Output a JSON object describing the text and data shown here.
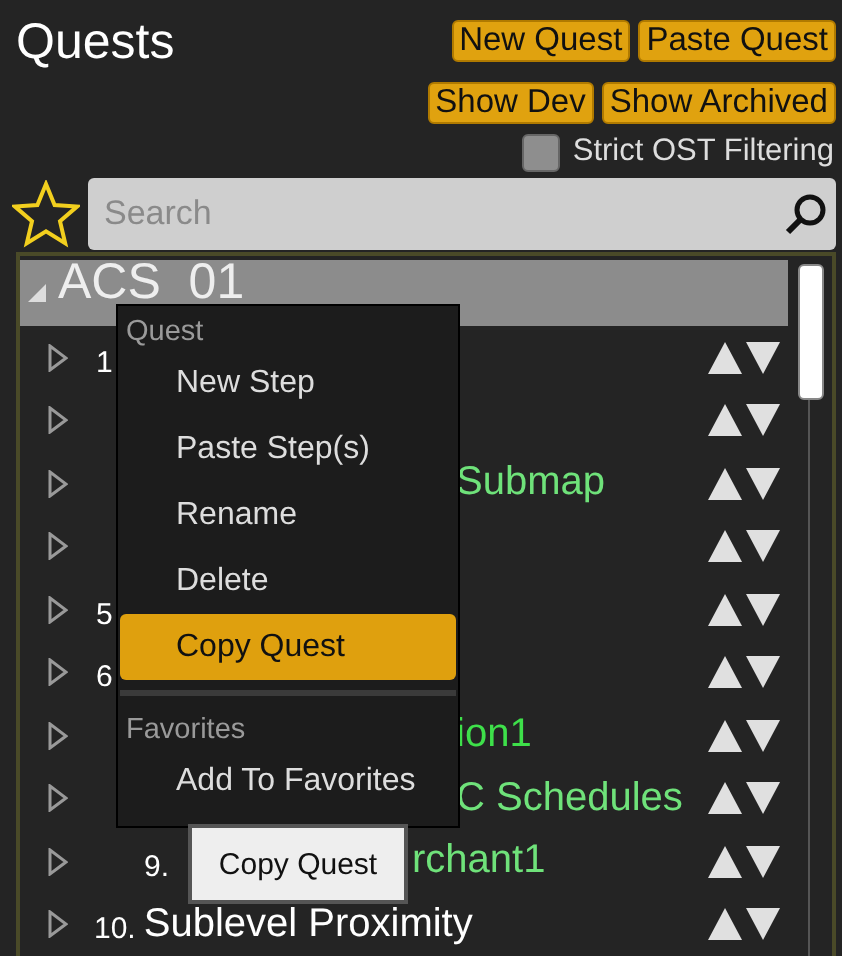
{
  "title": "Quests",
  "top_buttons": [
    {
      "label": "New Quest"
    },
    {
      "label": "Paste Quest"
    }
  ],
  "filter_buttons": [
    {
      "label": "Show Dev"
    },
    {
      "label": "Show Archived"
    }
  ],
  "strict_filter": {
    "label": "Strict OST Filtering",
    "checked": false
  },
  "search": {
    "placeholder": "Search"
  },
  "quest": {
    "name": "ACS_01",
    "expanded": true,
    "steps": [
      {
        "number": "1",
        "kind": "under-menu",
        "expanded": false
      },
      {
        "kind": "under-menu",
        "expanded": false
      },
      {
        "name": "Submap",
        "color": "#6fe27a",
        "kind": "under-menu",
        "expanded": false
      },
      {
        "kind": "under-menu",
        "expanded": false
      },
      {
        "number": "5",
        "kind": "under-menu",
        "expanded": false
      },
      {
        "number": "6",
        "kind": "under-menu",
        "expanded": false
      },
      {
        "name": "ion1",
        "color": "#3ee04a",
        "kind": "under-menu",
        "expanded": false
      },
      {
        "name": "C Schedules",
        "color": "#6fe27a",
        "kind": "under-menu",
        "expanded": false
      },
      {
        "number": "9.",
        "name": "rchant1",
        "color": "#6fe27a",
        "kind": "under-tooltip",
        "expanded": false
      },
      {
        "number": "10.",
        "name": "Sublevel Proximity",
        "color": "#ffffff",
        "kind": "plain",
        "expanded": false
      }
    ]
  },
  "context_menu": {
    "sections": [
      {
        "heading": "Quest",
        "items": [
          {
            "label": "New Step",
            "selected": false
          },
          {
            "label": "Paste Step(s)",
            "selected": false
          },
          {
            "label": "Rename",
            "selected": false
          },
          {
            "label": "Delete",
            "selected": false
          },
          {
            "label": "Copy Quest",
            "selected": true
          }
        ]
      },
      {
        "heading": "Favorites",
        "items": [
          {
            "label": "Add To Favorites",
            "selected": false
          }
        ]
      }
    ]
  },
  "tooltip": {
    "text": "Copy Quest"
  }
}
